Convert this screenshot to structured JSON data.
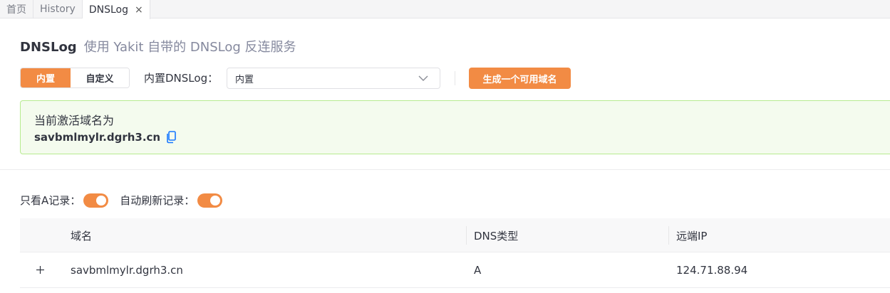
{
  "tabs": [
    {
      "label": "首页"
    },
    {
      "label": "History"
    },
    {
      "label": "DNSLog",
      "active": true
    }
  ],
  "tab_close_icon": "×",
  "header": {
    "title": "DNSLog",
    "subtitle": "使用 Yakit 自带的 DNSLog 反连服务"
  },
  "mode": {
    "options": [
      "内置",
      "自定义"
    ],
    "selected": "内置"
  },
  "dnslog_select": {
    "label": "内置DNSLog：",
    "value": "内置"
  },
  "generate_button": "生成一个可用域名",
  "active_domain": {
    "title": "当前激活域名为",
    "domain": "savbmlmylr.dgrh3.cn"
  },
  "filters": {
    "only_a_label": "只看A记录：",
    "only_a_on": true,
    "auto_refresh_label": "自动刷新记录：",
    "auto_refresh_on": true
  },
  "table": {
    "columns": [
      "域名",
      "DNS类型",
      "远端IP"
    ],
    "rows": [
      {
        "domain": "savbmlmylr.dgrh3.cn",
        "type": "A",
        "ip": "124.71.88.94"
      }
    ]
  },
  "colors": {
    "accent": "#f28b44",
    "success_bg": "#f4fbee",
    "success_border": "#b7eb8f",
    "link": "#1677ff"
  }
}
